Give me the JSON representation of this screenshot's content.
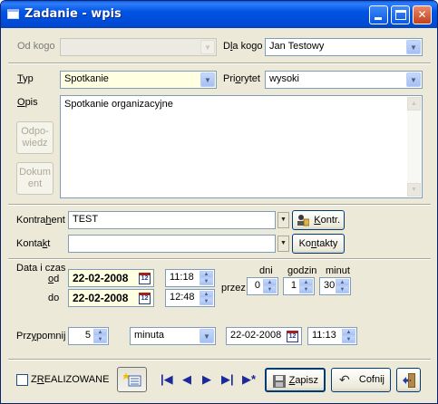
{
  "window": {
    "title": "Zadanie - wpis"
  },
  "colors": {
    "titlebar": "#0054e3",
    "window_bg": "#ece9d8",
    "close_button": "#c2401b"
  },
  "od_kogo": {
    "label": "Od kogo",
    "value": ""
  },
  "dla_kogo": {
    "label_pre": "D",
    "label_u": "l",
    "label_post": "a kogo",
    "value": "Jan Testowy"
  },
  "typ": {
    "label_u": "T",
    "label_post": "yp",
    "value": "Spotkanie"
  },
  "priorytet": {
    "label_pre": "Pri",
    "label_u": "o",
    "label_post": "rytet",
    "value": "wysoki"
  },
  "opis": {
    "label_u": "O",
    "label_post": "pis",
    "text": "Spotkanie organizacyjne"
  },
  "left_buttons": {
    "odpowiedz": [
      "Odpo-",
      "wiedz"
    ],
    "dokument": [
      "Dokum",
      "ent"
    ]
  },
  "kontrahent": {
    "label_pre": "Kontra",
    "label_u": "h",
    "label_post": "ent",
    "value": "TEST",
    "button_u": "K",
    "button_post": "ontr."
  },
  "kontakt": {
    "label_pre": "Konta",
    "label_u": "k",
    "label_post": "t",
    "value": "",
    "button_pre": "Ko",
    "button_u": "n",
    "button_post": "takty"
  },
  "data": {
    "label": "Data i czas",
    "od_label_u": "o",
    "od_label_post": "d",
    "do_label": "do",
    "od_date": "22-02-2008",
    "od_time": "11:18",
    "do_date": "22-02-2008",
    "do_time": "12:48",
    "calendar_icon_text": "12"
  },
  "przez": {
    "label": "przez",
    "dni_label": "dni",
    "dni_value": "0",
    "godzin_label": "godzin",
    "godzin_value": "1",
    "minut_label": "minut",
    "minut_value": "30"
  },
  "przypomnij": {
    "label_pre": "Prz",
    "label_u": "y",
    "label_post": "pomnij",
    "count": "5",
    "unit": "minuta",
    "date": "22-02-2008",
    "time": "11:13"
  },
  "footer": {
    "zrealizowane_pre": "Z",
    "zrealizowane_u": "R",
    "zrealizowane_post": "EALIZOWANE",
    "zrealizowane_checked": false,
    "zapisz_u": "Z",
    "zapisz_post": "apisz",
    "cofnij": "Cofnij"
  },
  "icons": [
    "window-icon",
    "minimize-icon",
    "maximize-icon",
    "close-icon",
    "contact-card-icon",
    "calendar-icon",
    "list-icon",
    "first-record-icon",
    "prev-record-icon",
    "next-record-icon",
    "last-record-icon",
    "new-record-icon",
    "save-icon",
    "undo-icon",
    "exit-door-icon"
  ]
}
